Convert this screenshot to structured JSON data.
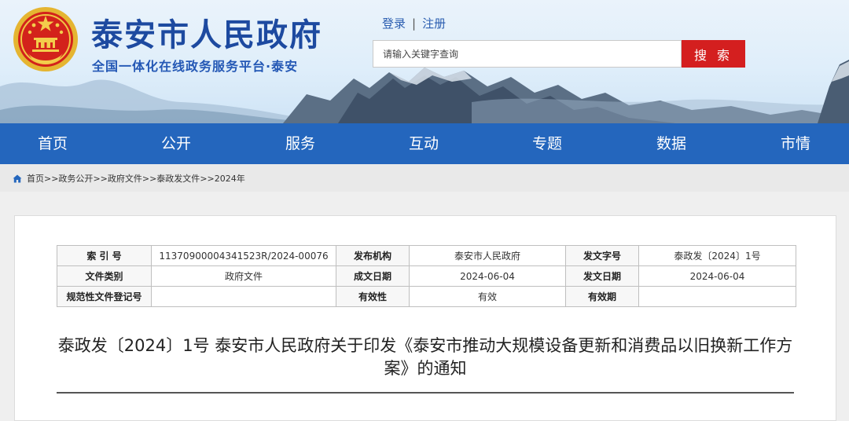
{
  "header": {
    "site_title": "泰安市人民政府",
    "site_subtitle": "全国一体化在线政务服务平台·泰安",
    "login": "登录",
    "auth_separator": "|",
    "register": "注册",
    "search_placeholder": "请输入关键字查询",
    "search_button": "搜 索"
  },
  "nav": {
    "items": [
      "首页",
      "公开",
      "服务",
      "互动",
      "专题",
      "数据",
      "市情"
    ]
  },
  "breadcrumb": {
    "items": [
      "首页",
      ">>政务公开",
      ">>政府文件",
      ">>泰政发文件",
      ">>2024年"
    ]
  },
  "info_table": {
    "row1": {
      "l1": "索 引 号",
      "v1": "11370900004341523R/2024-00076",
      "l2": "发布机构",
      "v2": "泰安市人民政府",
      "l3": "发文字号",
      "v3": "泰政发〔2024〕1号"
    },
    "row2": {
      "l1": "文件类别",
      "v1": "政府文件",
      "l2": "成文日期",
      "v2": "2024-06-04",
      "l3": "发文日期",
      "v3": "2024-06-04"
    },
    "row3": {
      "l1": "规范性文件登记号",
      "v1": "",
      "l2": "有效性",
      "v2": "有效",
      "l3": "有效期",
      "v3": ""
    }
  },
  "document": {
    "title": "泰政发〔2024〕1号 泰安市人民政府关于印发《泰安市推动大规模设备更新和消费品以旧换新工作方案》的通知"
  },
  "colors": {
    "brand_blue": "#1d4aa0",
    "nav_blue": "#2466bd",
    "search_red": "#d41f1f"
  }
}
